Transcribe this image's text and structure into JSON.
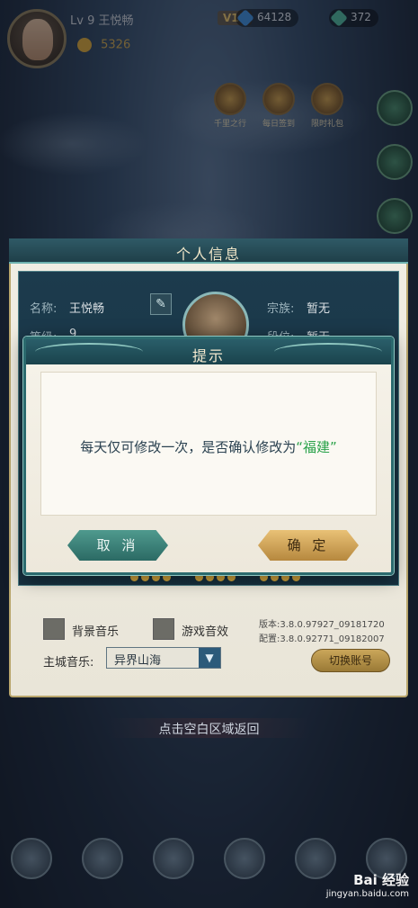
{
  "player": {
    "level": "Lv 9",
    "name": "王悦畅",
    "vip": "V11",
    "gems": "64128",
    "jade": "372",
    "gold": "5326"
  },
  "top_icons": [
    "千里之行",
    "每日签到",
    "限时礼包"
  ],
  "info_panel": {
    "title": "个人信息",
    "name_label": "名称:",
    "name_value": "王悦畅",
    "clan_label": "宗族:",
    "clan_value": "暂无",
    "level_label": "等级:",
    "level_value": "9",
    "rank_label": "段位:",
    "rank_value": "暂无"
  },
  "settings": {
    "bg_music_label": "背景音乐",
    "game_sfx_label": "游戏音效",
    "version_line1": "版本:3.8.0.97927_09181720",
    "version_line2": "配置:3.8.0.92771_09182007",
    "city_music_label": "主城音乐:",
    "city_music_value": "异界山海",
    "switch_account": "切换账号"
  },
  "return_hint": "点击空白区域返回",
  "dialog": {
    "title": "提示",
    "message_prefix": "每天仅可修改一次，是否确认修改为",
    "message_highlight": "“福建”",
    "cancel": "取 消",
    "confirm": "确 定"
  },
  "watermark": {
    "brand": "Bai 经验",
    "url": "jingyan.baidu.com"
  }
}
